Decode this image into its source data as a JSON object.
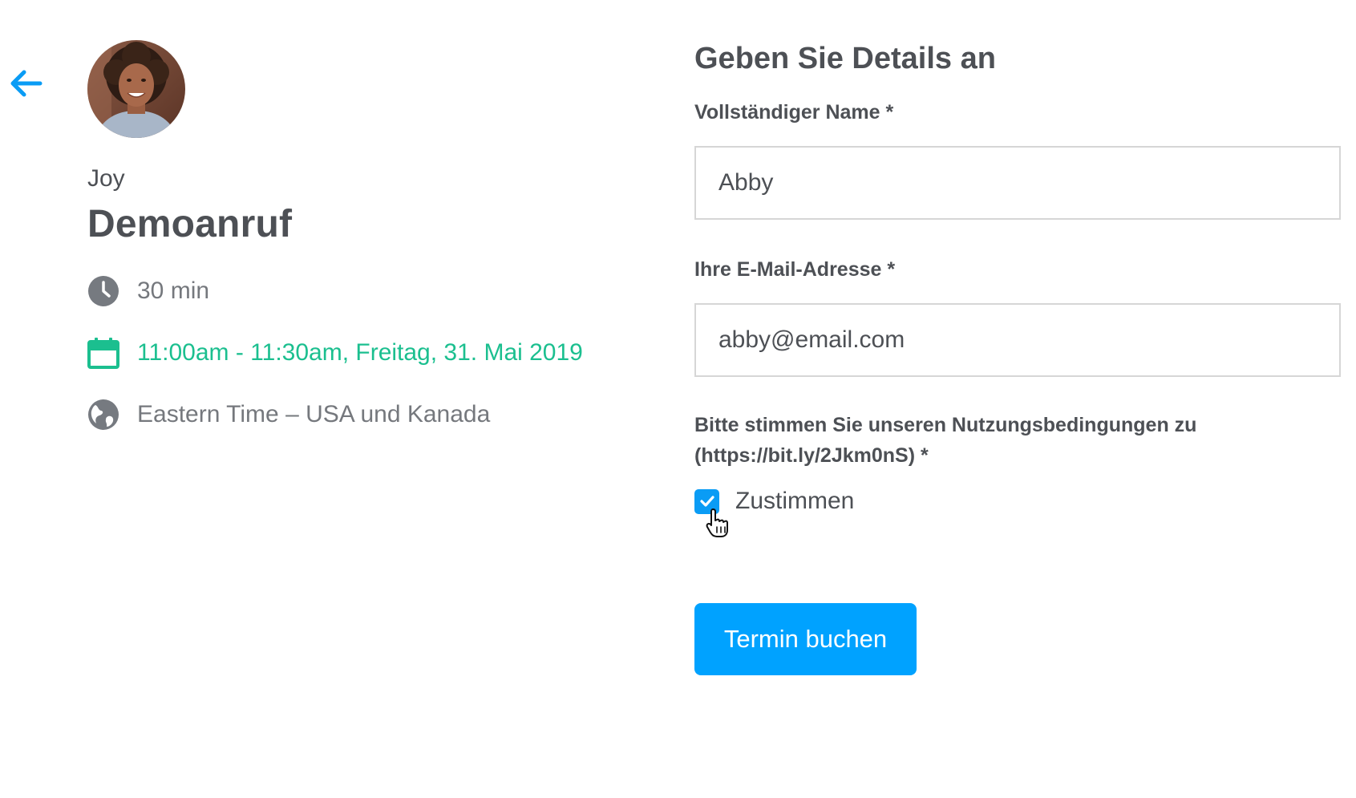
{
  "colors": {
    "accent": "#00a2ff",
    "datetime_green": "#1bbf8f",
    "text": "#4d5055",
    "muted": "#75787d",
    "icon_gray": "#767a80"
  },
  "nav": {
    "back_icon": "arrow-left-icon"
  },
  "event": {
    "avatar_icon": "host-avatar",
    "host_name": "Joy",
    "title": "Demoanruf",
    "duration_icon": "clock-icon",
    "duration": "30 min",
    "datetime_icon": "calendar-icon",
    "datetime": "11:00am - 11:30am, Freitag, 31. Mai 2019",
    "timezone_icon": "globe-icon",
    "timezone": "Eastern Time – USA und Kanada"
  },
  "form": {
    "heading": "Geben Sie Details an",
    "name_label": "Vollständiger Name *",
    "name_value": "Abby",
    "email_label": "Ihre E-Mail-Adresse *",
    "email_value": "abby@email.com",
    "terms_line1": "Bitte stimmen Sie unseren Nutzungsbedingungen zu",
    "terms_line2": "(https://bit.ly/2Jkm0nS) *",
    "agree_checked": true,
    "agree_label": "Zustimmen",
    "submit_label": "Termin buchen"
  }
}
